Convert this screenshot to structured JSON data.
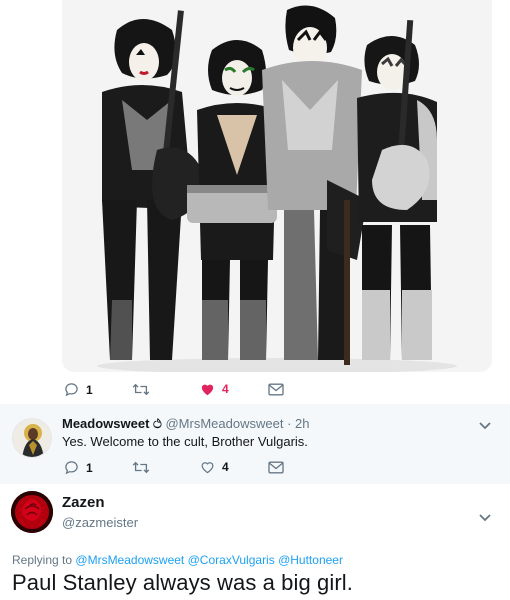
{
  "photo_tweet": {
    "actions": {
      "reply_count": "1",
      "retweet_count": "",
      "like_count": "4",
      "colors": {
        "like": "#e0245e",
        "icon": "#657786"
      }
    }
  },
  "reply_tweet": {
    "name": "Meadowsweet",
    "name_symbol": "ථ",
    "handle": "@MrsMeadowsweet",
    "separator": "·",
    "time": "2h",
    "text": "Yes. Welcome to the cult, Brother Vulgaris.",
    "actions": {
      "reply_count": "1",
      "retweet_count": "",
      "like_count": "4"
    }
  },
  "main_tweet": {
    "name": "Zazen",
    "handle": "@zazmeister",
    "replying_prefix": "Replying to",
    "mentions": [
      "@MrsMeadowsweet",
      "@CoraxVulgaris",
      "@Huttoneer"
    ],
    "text": "Paul Stanley always was a big girl."
  }
}
